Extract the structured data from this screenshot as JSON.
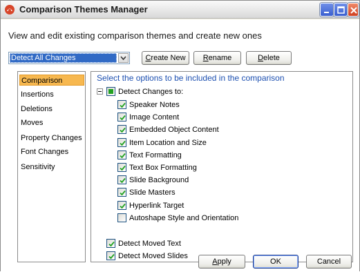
{
  "window": {
    "title": "Comparison Themes Manager"
  },
  "description": "View and edit existing comparison themes and create new ones",
  "theme_selector": {
    "selected": "Detect All Changes"
  },
  "toolbar": {
    "create_new": {
      "label": "Create New",
      "mnemonic": "C",
      "rest": "reate New"
    },
    "rename": {
      "label": "Rename",
      "mnemonic": "R",
      "rest": "ename"
    },
    "delete": {
      "label": "Delete",
      "mnemonic": "D",
      "rest": "elete"
    }
  },
  "categories": [
    {
      "label": "Comparison",
      "selected": true
    },
    {
      "label": "Insertions",
      "selected": false
    },
    {
      "label": "Deletions",
      "selected": false
    },
    {
      "label": "Moves",
      "selected": false
    },
    {
      "label": "Property Changes",
      "selected": false
    },
    {
      "label": "Font Changes",
      "selected": false
    },
    {
      "label": "Sensitivity",
      "selected": false
    }
  ],
  "options": {
    "heading": "Select the options to be included in the comparison",
    "detect_changes": {
      "label": "Detect Changes to:",
      "state": "partial",
      "children": [
        {
          "label": "Speaker Notes",
          "checked": true
        },
        {
          "label": "Image Content",
          "checked": true
        },
        {
          "label": "Embedded Object Content",
          "checked": true
        },
        {
          "label": "Item Location and Size",
          "checked": true
        },
        {
          "label": "Text Formatting",
          "checked": true
        },
        {
          "label": "Text Box Formatting",
          "checked": true
        },
        {
          "label": "Slide Background",
          "checked": true
        },
        {
          "label": "Slide Masters",
          "checked": true
        },
        {
          "label": "Hyperlink Target",
          "checked": true
        },
        {
          "label": "Autoshape Style and Orientation",
          "checked": false
        }
      ]
    },
    "detect_moved_text": {
      "label": "Detect Moved Text",
      "checked": true
    },
    "detect_moved_slides": {
      "label": "Detect Moved Slides",
      "checked": true
    }
  },
  "footer": {
    "apply": {
      "label": "Apply",
      "mnemonic": "A",
      "rest": "pply"
    },
    "ok": "OK",
    "cancel": "Cancel"
  },
  "colors": {
    "selection": "#f7b84f",
    "heading_blue": "#1c4fb0",
    "check_green": "#21a121",
    "close_red": "#d04020"
  }
}
